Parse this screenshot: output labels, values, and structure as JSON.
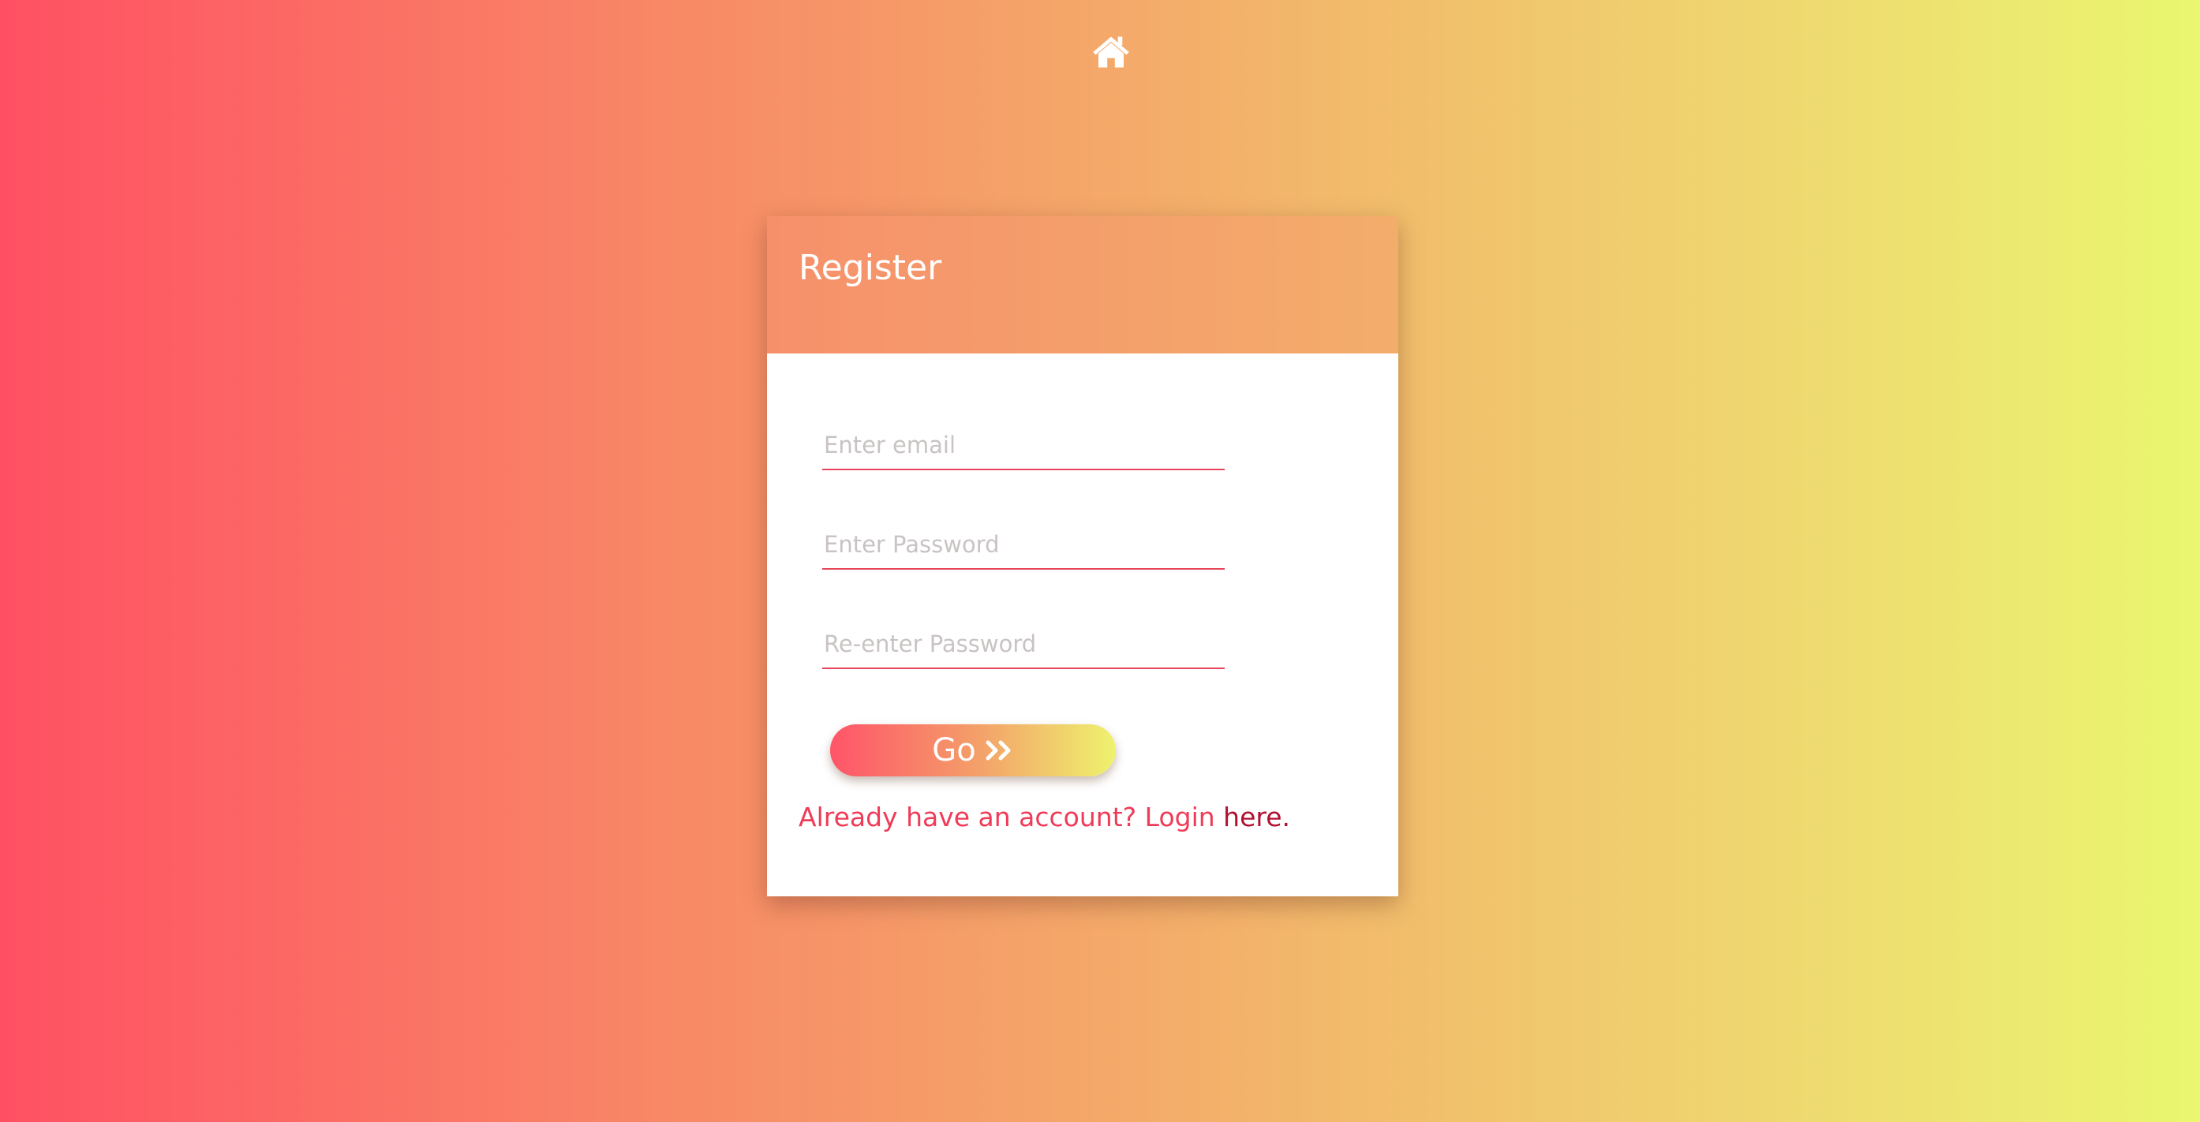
{
  "nav": {
    "home_icon": "home-icon"
  },
  "register": {
    "title": "Register",
    "email_placeholder": "Enter email",
    "password_placeholder": "Enter Password",
    "reenter_placeholder": "Re-enter Password",
    "submit_label": "Go",
    "submit_icon": "double-chevron-right-icon",
    "login_prompt": "Already have an account? Login",
    "login_link": "here."
  },
  "colors": {
    "gradient_start": "#ff5063",
    "gradient_end": "#eaf76f",
    "accent": "#e8445a",
    "link": "#b01031"
  }
}
